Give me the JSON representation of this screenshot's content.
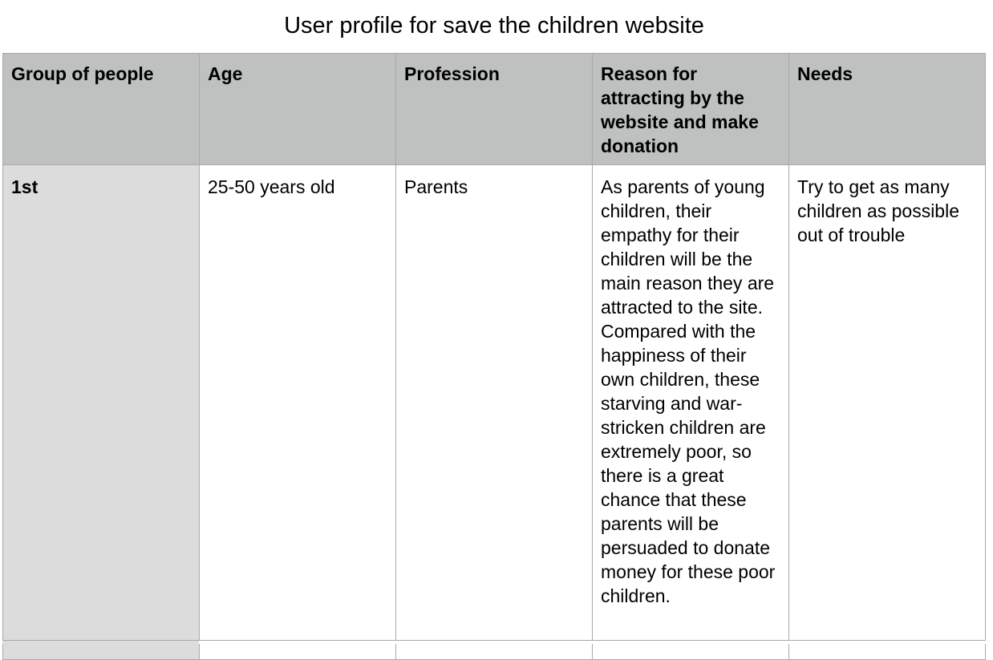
{
  "document": {
    "title": "User profile for save the children website"
  },
  "table": {
    "headers": [
      "Group of people",
      "Age",
      "Profession",
      "Reason for attracting by the website and make donation",
      "Needs"
    ],
    "rows": [
      {
        "group": "1st",
        "age": "25-50 years old",
        "profession": "Parents",
        "reason": "As parents of young children, their empathy for their children will be the main reason they are attracted to the site. Compared with the happiness of their own children, these starving and war-stricken children are extremely poor, so there is a great chance that these parents will be persuaded to donate money for these poor children.",
        "needs": "Try to get as many children as possible out of trouble"
      }
    ]
  },
  "colors": {
    "header_bg": "#bec1c0",
    "row_head_bg": "#dcdcdc",
    "border": "#a9a9a9"
  }
}
